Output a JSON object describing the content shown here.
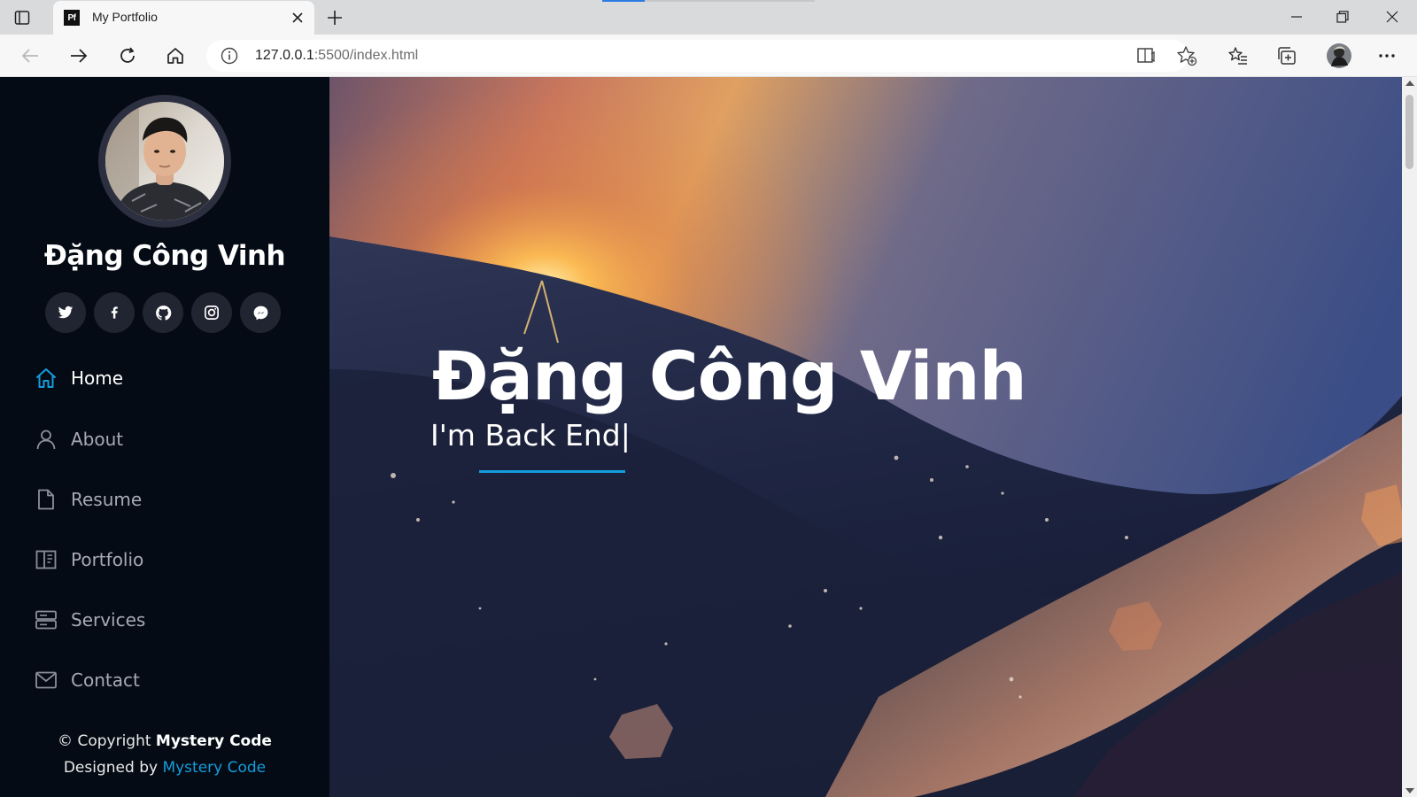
{
  "browser": {
    "tab_title": "My Portfolio",
    "tab_favicon_text": "Pf",
    "url_host": "127.0.0.1",
    "url_rest": ":5500/index.html"
  },
  "sidebar": {
    "profile_name": "Đặng Công Vinh",
    "socials": [
      {
        "name": "twitter-icon"
      },
      {
        "name": "facebook-icon"
      },
      {
        "name": "github-icon"
      },
      {
        "name": "instagram-icon"
      },
      {
        "name": "messenger-icon"
      }
    ],
    "nav": [
      {
        "label": "Home",
        "icon": "home-icon",
        "active": true
      },
      {
        "label": "About",
        "icon": "user-icon",
        "active": false
      },
      {
        "label": "Resume",
        "icon": "file-icon",
        "active": false
      },
      {
        "label": "Portfolio",
        "icon": "book-icon",
        "active": false
      },
      {
        "label": "Services",
        "icon": "server-icon",
        "active": false
      },
      {
        "label": "Contact",
        "icon": "envelope-icon",
        "active": false
      }
    ],
    "footer": {
      "copyright_prefix": "© Copyright ",
      "copyright_brand": "Mystery Code",
      "designed_prefix": "Designed by ",
      "designed_link": "Mystery Code"
    }
  },
  "hero": {
    "title": "Đặng Công Vinh",
    "subtitle": "I'm Back End",
    "cursor": "|"
  },
  "colors": {
    "accent": "#149ddd",
    "sidebar_bg": "#040b14",
    "social_bg": "#212431"
  }
}
